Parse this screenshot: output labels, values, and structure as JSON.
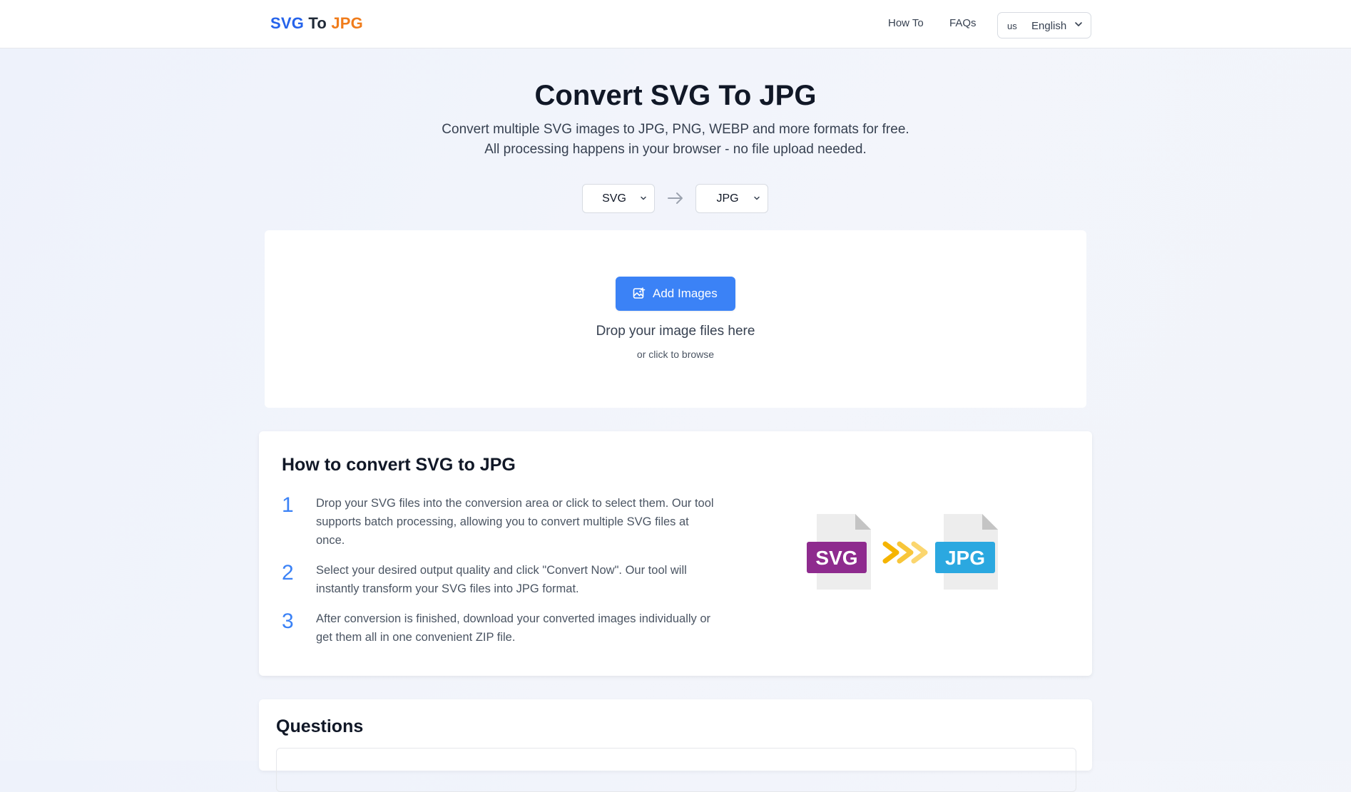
{
  "header": {
    "logo": {
      "part1": "SVG",
      "part2": "To",
      "part3": "JPG"
    },
    "nav": [
      {
        "label": "How To"
      },
      {
        "label": "FAQs"
      }
    ],
    "language": {
      "code": "us",
      "label": "English"
    }
  },
  "hero": {
    "title": "Convert SVG To JPG",
    "subtitle_line1": "Convert multiple SVG images to JPG, PNG, WEBP and more formats for free.",
    "subtitle_line2": "All processing happens in your browser - no file upload needed."
  },
  "converter": {
    "from_format": "SVG",
    "to_format": "JPG"
  },
  "dropzone": {
    "button_label": "Add Images",
    "main_text": "Drop your image files here",
    "sub_text": "or click to browse"
  },
  "howto": {
    "title": "How to convert SVG to JPG",
    "steps": [
      {
        "num": "1",
        "text": "Drop your SVG files into the conversion area or click to select them. Our tool supports batch processing, allowing you to convert multiple SVG files at once."
      },
      {
        "num": "2",
        "text": "Select your desired output quality and click \"Convert Now\". Our tool will instantly transform your SVG files into JPG format."
      },
      {
        "num": "3",
        "text": "After conversion is finished, download your converted images individually or get them all in one convenient ZIP file."
      }
    ],
    "illustration": {
      "from_label": "SVG",
      "to_label": "JPG"
    }
  },
  "questions": {
    "title": "Questions"
  },
  "colors": {
    "primary": "#3b82f6",
    "logo_blue": "#2563eb",
    "logo_orange": "#f07c1b",
    "svg_badge": "#8e2b8e",
    "jpg_badge": "#2ba8e0",
    "chevron_arrows": "#f5b400"
  }
}
